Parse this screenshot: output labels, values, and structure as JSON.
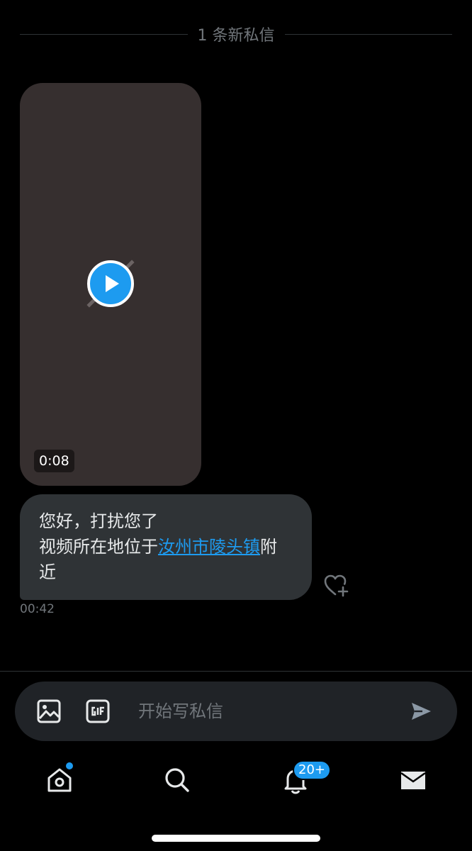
{
  "divider": {
    "new_messages_label": "1 条新私信"
  },
  "video_message": {
    "duration": "0:08"
  },
  "text_message": {
    "line1": "您好，打扰您了",
    "line2_prefix": "视频所在地位于",
    "location_link": "汝州市陵头镇",
    "line2_suffix": "附",
    "line3": "近",
    "timestamp": "00:42"
  },
  "composer": {
    "placeholder": "开始写私信",
    "icons": [
      "image-icon",
      "gif-icon",
      "send-icon"
    ]
  },
  "bottom_nav": {
    "items": [
      "home",
      "search",
      "notifications",
      "messages"
    ],
    "notifications_badge": "20+"
  },
  "colors": {
    "background": "#000000",
    "accent": "#1d9bf0",
    "bubble": "#2f3336",
    "video_placeholder": "#362f2f",
    "muted_text": "#71767b"
  }
}
